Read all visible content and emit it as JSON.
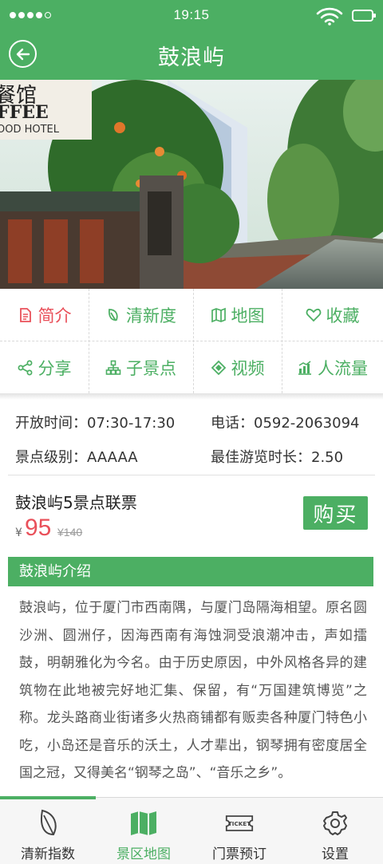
{
  "status_bar": {
    "time": "19:15"
  },
  "header": {
    "title": "鼓浪屿"
  },
  "menu": [
    {
      "label": "简介",
      "icon": "document-icon"
    },
    {
      "label": "清新度",
      "icon": "leaf-icon"
    },
    {
      "label": "地图",
      "icon": "map-icon"
    },
    {
      "label": "收藏",
      "icon": "heart-icon"
    },
    {
      "label": "分享",
      "icon": "share-icon"
    },
    {
      "label": "子景点",
      "icon": "hierarchy-icon"
    },
    {
      "label": "视频",
      "icon": "ticket-tag-icon"
    },
    {
      "label": "人流量",
      "icon": "bar-chart-icon"
    }
  ],
  "info": {
    "open_label": "开放时间：",
    "open_value": "07:30-17:30",
    "phone_label": "电话：",
    "phone_value": "0592-2063094",
    "level_label": "景点级别：",
    "level_value": "AAAAA",
    "duration_label": "最佳游览时长：",
    "duration_value": "2.50"
  },
  "ticket": {
    "name": "鼓浪屿5景点联票",
    "currency": "¥",
    "price": "95",
    "old_price": "¥140",
    "buy_label": "购买"
  },
  "intro": {
    "heading": "鼓浪屿介绍",
    "text": "鼓浪屿，位于厦门市西南隅，与厦门岛隔海相望。原名圆沙洲、圆洲仔，因海西南有海蚀洞受浪潮冲击，声如擂鼓，明朝雅化为今名。由于历史原因，中外风格各异的建筑物在此地被完好地汇集、保留，有“万国建筑博览”之称。龙头路商业街诸多火热商铺都有贩卖各种厦门特色小吃，小岛还是音乐的沃土，人才辈出，钢琴拥有密度居全国之冠，又得美名“钢琴之岛”、“音乐之乡”。"
  },
  "hero": {
    "sign_line1": "餐馆",
    "sign_line2": "FFEE",
    "sign_line3": "OOD HOTEL"
  },
  "tabs": [
    {
      "label": "清新指数",
      "icon": "leaf-icon"
    },
    {
      "label": "景区地图",
      "icon": "map-icon"
    },
    {
      "label": "门票预订",
      "icon": "ticket-icon",
      "ticket_text": "TICKET"
    },
    {
      "label": "设置",
      "icon": "gear-icon"
    }
  ],
  "colors": {
    "primary": "#4caf63",
    "accent": "#e9505a"
  }
}
